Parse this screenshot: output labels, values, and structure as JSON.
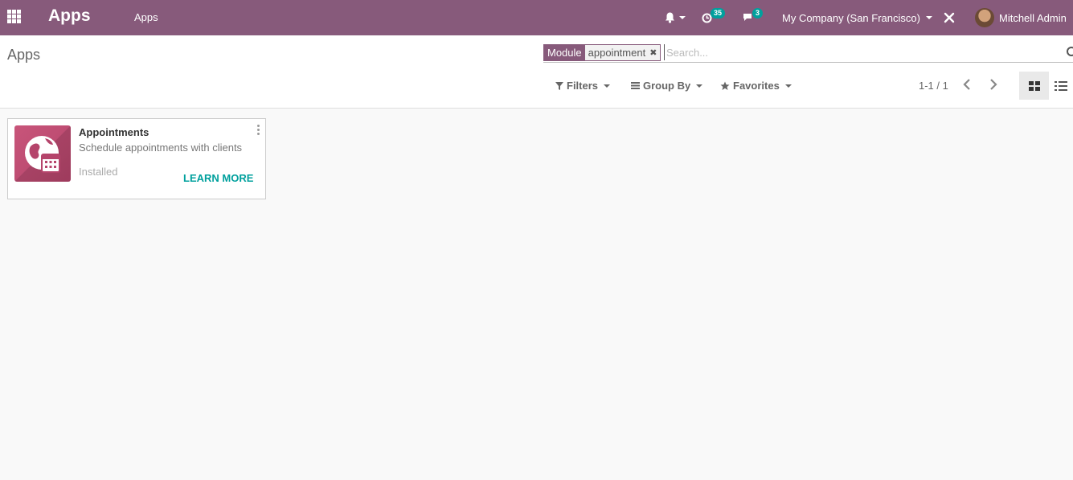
{
  "navbar": {
    "brand": "Apps",
    "menu_item": "Apps",
    "activity_count": "35",
    "message_count": "3",
    "company": "My Company (San Francisco)",
    "user_name": "Mitchell Admin"
  },
  "control_panel": {
    "breadcrumb": "Apps",
    "search": {
      "facet_label": "Module",
      "facet_value": "appointment",
      "placeholder": "Search..."
    },
    "filters_label": "Filters",
    "group_by_label": "Group By",
    "favorites_label": "Favorites",
    "pager_value": "1-1 / 1"
  },
  "apps": [
    {
      "name": "Appointments",
      "summary": "Schedule appointments with clients",
      "status": "Installed",
      "action_label": "LEARN MORE",
      "icon": "appointment-globe-calendar-icon"
    }
  ],
  "colors": {
    "brand": "#875a7b",
    "accent": "#00a09d"
  }
}
